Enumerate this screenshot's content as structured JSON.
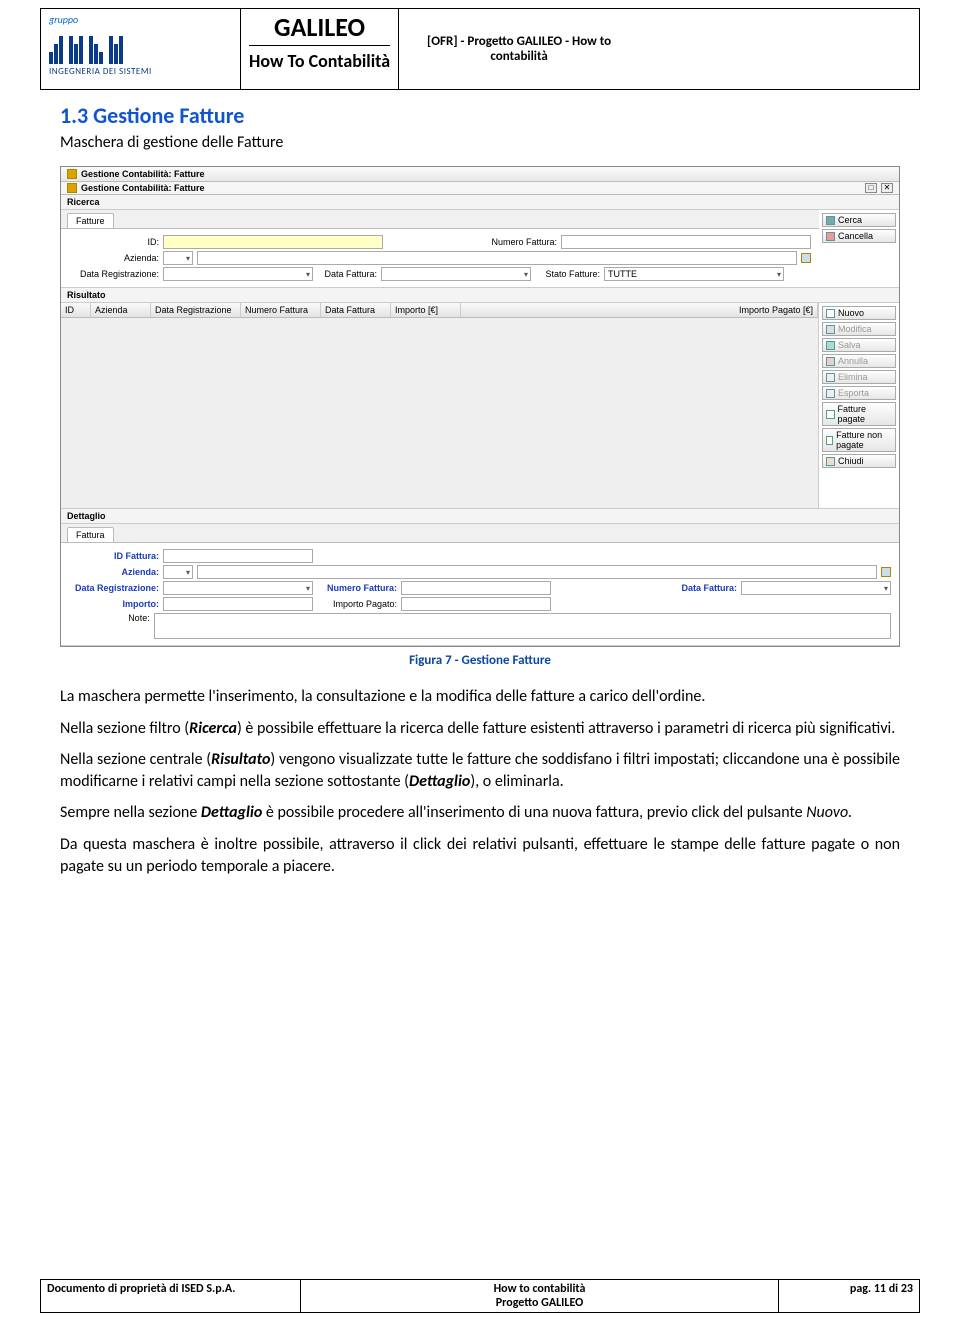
{
  "header": {
    "logo": {
      "gruppo": "gruppo",
      "subtitle": "INGEGNERIA DEI SISTEMI"
    },
    "center_top": "GALILEO",
    "center_bottom": "How To Contabilità",
    "right": "[OFR] - Progetto GALILEO - How to contabilità"
  },
  "section": {
    "number_title": "1.3 Gestione Fatture",
    "subtitle": "Maschera di gestione delle Fatture"
  },
  "app": {
    "outer_title": "Gestione Contabilità: Fatture",
    "inner_title": "Gestione Contabilità: Fatture",
    "ricerca": {
      "panel_label": "Ricerca",
      "tab_label": "Fatture",
      "id_label": "ID:",
      "numero_fattura_label": "Numero Fattura:",
      "azienda_label": "Azienda:",
      "data_registrazione_label": "Data Registrazione:",
      "data_fattura_label": "Data Fattura:",
      "stato_fatture_label": "Stato Fatture:",
      "stato_fatture_value": "TUTTE",
      "buttons": {
        "cerca": "Cerca",
        "cancella": "Cancella"
      }
    },
    "risultato": {
      "panel_label": "Risultato",
      "columns": [
        "ID",
        "Azienda",
        "Data Registrazione",
        "Numero Fattura",
        "Data Fattura",
        "Importo [€]",
        "Importo Pagato [€]"
      ],
      "buttons": {
        "nuovo": "Nuovo",
        "modifica": "Modifica",
        "salva": "Salva",
        "annulla": "Annulla",
        "elimina": "Elimina",
        "esporta": "Esporta",
        "fatture_pagate": "Fatture pagate",
        "fatture_non_pagate": "Fatture non pagate",
        "chiudi": "Chiudi"
      }
    },
    "dettaglio": {
      "panel_label": "Dettaglio",
      "tab_label": "Fattura",
      "id_fattura_label": "ID Fattura:",
      "azienda_label": "Azienda:",
      "data_registrazione_label": "Data Registrazione:",
      "numero_fattura_label": "Numero Fattura:",
      "data_fattura_label": "Data Fattura:",
      "importo_label": "Importo:",
      "importo_pagato_label": "Importo Pagato:",
      "note_label": "Note:"
    }
  },
  "caption": "Figura 7 - Gestione Fatture",
  "body": {
    "p1": "La maschera permette l'inserimento, la consultazione e la modifica delle fatture a carico dell'ordine.",
    "p2a": "Nella sezione filtro (",
    "p2b": "Ricerca",
    "p2c": ") è possibile effettuare la ricerca delle fatture esistenti attraverso i parametri di ricerca più significativi.",
    "p3a": "Nella sezione centrale (",
    "p3b": "Risultato",
    "p3c": ") vengono visualizzate tutte le fatture che soddisfano i filtri impostati; cliccandone una è possibile modificarne i relativi campi nella sezione sottostante (",
    "p3d": "Dettaglio",
    "p3e": "), o eliminarla.",
    "p4a": "Sempre nella sezione ",
    "p4b": "Dettaglio",
    "p4c": " è possibile procedere all'inserimento di una nuova fattura, previo click del pulsante ",
    "p4d": "Nuovo.",
    "p5": "Da questa maschera è inoltre possibile, attraverso il click dei relativi pulsanti, effettuare le stampe delle fatture pagate o non pagate su un periodo temporale a piacere."
  },
  "footer": {
    "left": "Documento di proprietà di ISED S.p.A.",
    "center_line1": "How to contabilità",
    "center_line2": "Progetto GALILEO",
    "right": "pag. 11 di 23"
  }
}
